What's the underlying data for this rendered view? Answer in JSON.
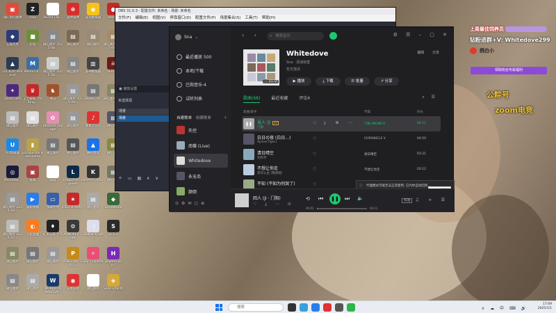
{
  "desktop_icons": [
    {
      "label": "(最) 新的版本",
      "color": "#e24a3b",
      "glyph": "▣"
    },
    {
      "label": "Ospi",
      "color": "#222",
      "glyph": "Z"
    },
    {
      "label": "b62d171b...",
      "color": "#fff",
      "glyph": "▦"
    },
    {
      "label": "雷神雷神",
      "color": "#d92d2d",
      "glyph": "⊕"
    },
    {
      "label": "雷电模拟器",
      "color": "#f7c31b",
      "glyph": "◉"
    },
    {
      "label": "RecGIF",
      "color": "#c62828",
      "glyph": "●"
    },
    {
      "label": "石城无畏",
      "color": "#2a3c7a",
      "glyph": "◆"
    },
    {
      "label": "猎猎",
      "color": "#6b8f3a",
      "glyph": "■"
    },
    {
      "label": "微信图片 2025-08...",
      "color": "#888",
      "glyph": "▤"
    },
    {
      "label": "微信图片",
      "color": "#7a6a55",
      "glyph": "▤"
    },
    {
      "label": "微信图片",
      "color": "#9a8a75",
      "glyph": "▤"
    },
    {
      "label": "微信图片 2025-09...",
      "color": "#a58a6a",
      "glyph": "▤"
    },
    {
      "label": "LOCKDO Protocol",
      "color": "#2b3b55",
      "glyph": "▲"
    },
    {
      "label": "MemoTra...",
      "color": "#3b6ea5",
      "glyph": "M"
    },
    {
      "label": "微信图片 2025-08...",
      "color": "#ccc",
      "glyph": "▤"
    },
    {
      "label": "微信图片",
      "color": "#888",
      "glyph": "▤"
    },
    {
      "label": "雷神模拟器",
      "color": "#444",
      "glyph": "▥"
    },
    {
      "label": "DEVOUR",
      "color": "#6d1a1a",
      "glyph": "☠"
    },
    {
      "label": "Dead Cells",
      "color": "#4b2a7a",
      "glyph": "✦"
    },
    {
      "label": "王之骑城 The King...",
      "color": "#c62828",
      "glyph": "♛"
    },
    {
      "label": "书马",
      "color": "#a0522d",
      "glyph": "♞"
    },
    {
      "label": "微信图片 2025-09...",
      "color": "#999",
      "glyph": "▤"
    },
    {
      "label": "2bb9d176...",
      "color": "#777",
      "glyph": "▤"
    },
    {
      "label": "微信图片 2025...",
      "color": "#886",
      "glyph": "▤"
    },
    {
      "label": "微信图片",
      "color": "#bbb",
      "glyph": "▤"
    },
    {
      "label": "微信图片",
      "color": "#ddd",
      "glyph": "▤"
    },
    {
      "label": "Blossom Voyage",
      "color": "#e48fb3",
      "glyph": "✿"
    },
    {
      "label": "微信图片",
      "color": "#999",
      "glyph": "▤"
    },
    {
      "label": "网易云音乐",
      "color": "#d33",
      "glyph": "♪"
    },
    {
      "label": "微信图片",
      "color": "#556",
      "glyph": "▤"
    },
    {
      "label": "UU加速器",
      "color": "#1e88e5",
      "glyph": "U"
    },
    {
      "label": "Escape the Backrooms",
      "color": "#b8a24a",
      "glyph": "▮"
    },
    {
      "label": "微信图片",
      "color": "#777",
      "glyph": "▤"
    },
    {
      "label": "微信图片",
      "color": "#555",
      "glyph": "▤"
    },
    {
      "label": "腾讯会议",
      "color": "#1a73e8",
      "glyph": "▲"
    },
    {
      "label": "微信图片",
      "color": "#884",
      "glyph": "▤"
    },
    {
      "label": "NeonAby...",
      "color": "#1a1a3a",
      "glyph": "◎"
    },
    {
      "label": "逃离",
      "color": "#a44",
      "glyph": "▣"
    },
    {
      "label": "喵喵",
      "color": "#fff",
      "glyph": "☺"
    },
    {
      "label": "League of Legends",
      "color": "#0b2a4a",
      "glyph": "L"
    },
    {
      "label": "KAYAP Cemo",
      "color": "#333",
      "glyph": "K"
    },
    {
      "label": "微信图片",
      "color": "#776",
      "glyph": "▤"
    },
    {
      "label": "微信图片 2025-09...",
      "color": "#999",
      "glyph": "▤"
    },
    {
      "label": "喵影视频",
      "color": "#2b7de9",
      "glyph": "▶"
    },
    {
      "label": "书驿文件",
      "color": "#3a5fa8",
      "glyph": "▭"
    },
    {
      "label": "LIGO 8 Party!",
      "color": "#c62828",
      "glyph": "★"
    },
    {
      "label": "微信图片",
      "color": "#aaa",
      "glyph": "▤"
    },
    {
      "label": "Grindstone",
      "color": "#3a6a3a",
      "glyph": "◆"
    },
    {
      "label": "微信图片 2025-07...",
      "color": "#bbb",
      "glyph": "▤"
    },
    {
      "label": "斗鱼直播",
      "color": "#ff7a1a",
      "glyph": "◐"
    },
    {
      "label": "红黑与黑 无尽",
      "color": "#222",
      "glyph": "♦"
    },
    {
      "label": "ARMORED CORE",
      "color": "#3a3a3a",
      "glyph": "⚙"
    },
    {
      "label": "Hollow Knight",
      "color": "#dde",
      "glyph": "☽"
    },
    {
      "label": "SCS 3",
      "color": "#2a2a2a",
      "glyph": "S"
    },
    {
      "label": "微信图片",
      "color": "#886",
      "glyph": "▤"
    },
    {
      "label": "微信图片",
      "color": "#777",
      "glyph": "▤"
    },
    {
      "label": "微信图片",
      "color": "#999",
      "glyph": "▤"
    },
    {
      "label": "PUBG: BATTLEG...",
      "color": "#c48a1a",
      "glyph": "P"
    },
    {
      "label": "Sky: Children",
      "color": "#e94e77",
      "glyph": "✧"
    },
    {
      "label": "Beyond Boa...",
      "color": "#7a2ab5",
      "glyph": "H"
    },
    {
      "label": "微信图片",
      "color": "#888",
      "glyph": "▤"
    },
    {
      "label": "微信图片",
      "color": "#aaa",
      "glyph": "▤"
    },
    {
      "label": "WORLD OF WARCRAFT",
      "color": "#1a3a6a",
      "glyph": "W"
    },
    {
      "label": "开黑游戏",
      "color": "#d33",
      "glyph": "◉"
    },
    {
      "label": "微信图片",
      "color": "#fff",
      "glyph": "▤"
    },
    {
      "label": "Slide Effects",
      "color": "#d4a83a",
      "glyph": "◈"
    }
  ],
  "obs": {
    "title": "OBS 31.0.3 - 配置文件: 未命名 - 场景: 未命名",
    "menu": [
      "文件(F)",
      "编辑(E)",
      "视图(V)",
      "停靠窗口(D)",
      "配置文件(P)",
      "场景集合(S)",
      "工具(T)",
      "帮助(H)"
    ],
    "dock_title": "未选择源",
    "scenes_label": "场景",
    "scene_item": "场景"
  },
  "music": {
    "user": "Sna",
    "search_placeholder": "搜索音乐",
    "nav_items": [
      "最近播放 500",
      "本地/下载",
      "已购音乐·4",
      "试听列表"
    ],
    "playlists_label": "自建歌单",
    "playlists_tab2": "收藏歌单",
    "playlists": [
      {
        "name": "失控",
        "color": "#b33"
      },
      {
        "name": "南蝶 (Live)",
        "color": "#9ab"
      },
      {
        "name": "Whitedove",
        "color": "#ddd"
      },
      {
        "name": "永无岛",
        "color": "#556"
      },
      {
        "name": "颠倒",
        "color": "#8a6"
      }
    ],
    "playlist_title": "Whitedove",
    "playlist_author": "Sna · 添加标签",
    "playlist_desc": "暂无描述",
    "play_count": "6172",
    "edit_labels": [
      "编辑",
      "分享"
    ],
    "actions": [
      "播放",
      "下载",
      "批量",
      "分享"
    ],
    "tabs": [
      "歌曲(68)",
      "最近收藏",
      "评论4"
    ],
    "columns": [
      "歌曲/歌手",
      "专辑",
      "时长"
    ],
    "songs": [
      {
        "title": "虽人 (Ji",
        "artist": "门阳",
        "album": "门阳 (MONEY)",
        "duration": "04:11",
        "color": "#aaa",
        "active": true
      },
      {
        "title": "白日の夜 (白日...)",
        "artist": "Ayase(Tiger)",
        "album": "CHRONICLE V",
        "duration": "04:50",
        "color": "#556",
        "active": false
      },
      {
        "title": "清日晴空",
        "artist": "刘有宇",
        "album": "清日晴空",
        "duration": "03:21",
        "color": "#8ab",
        "active": false
      },
      {
        "title": "不想让你走",
        "artist": "李华公主 (我哈哈)",
        "album": "不想让你走",
        "duration": "03:12",
        "color": "#bcd",
        "active": false
      },
      {
        "title": "不知 (不知为何哭了)",
        "artist": "",
        "album": "",
        "duration": "",
        "color": "#9a8",
        "active": false
      }
    ],
    "toast": "代理模式可能无法正常使用, 已为你自动回到...",
    "tooltip": "已打开播放",
    "now_playing": {
      "title": "回人 (Ji · 门阳)",
      "time_elapsed": "00:01",
      "time_total": "04:11",
      "progress_pct": 1,
      "quality": "标准"
    }
  },
  "overlay": {
    "line1": "上周最佳饲养员",
    "line2": "钻粉进群+V: Whitedove299",
    "weibo": "鸽白小",
    "cta": "领取粉丝专属福利",
    "line4": "公粽号",
    "line5": "zoom电竞"
  },
  "taskbar": {
    "search_placeholder": "搜索",
    "time": "17:09",
    "date": "2025/1/1"
  },
  "colors": {
    "accent": "#1ec76e",
    "bg": "#1f1f22"
  }
}
